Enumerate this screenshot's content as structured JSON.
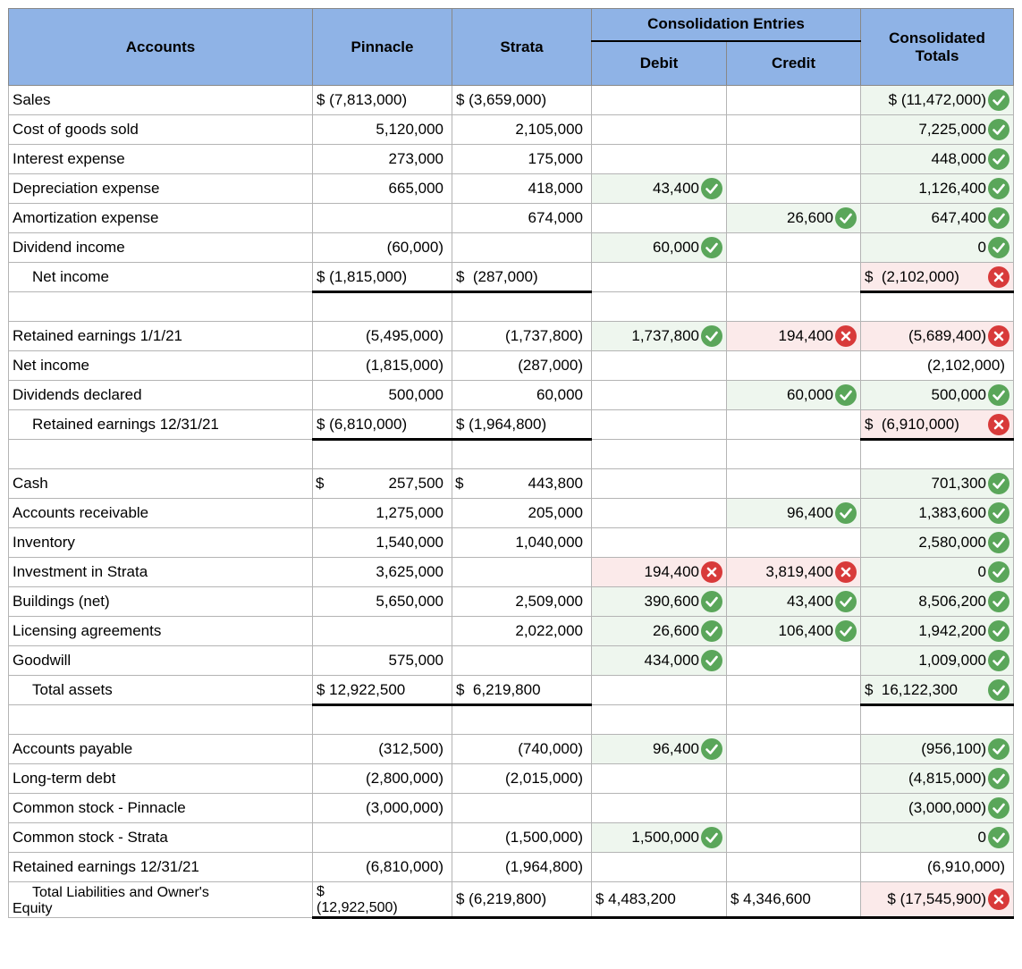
{
  "headers": {
    "accounts": "Accounts",
    "pinnacle": "Pinnacle",
    "strata": "Strata",
    "consolidation": "Consolidation Entries",
    "debit": "Debit",
    "credit": "Credit",
    "totals_line1": "Consolidated",
    "totals_line2": "Totals"
  },
  "status_colors": {
    "correct": "#5aa65a",
    "incorrect": "#d83a3a"
  },
  "rows": [
    {
      "type": "row",
      "name": "Sales",
      "p": "$ (7,813,000)",
      "s": "$ (3,659,000)",
      "d": "",
      "c": "",
      "t": "$ (11,472,000)",
      "ts": "correct"
    },
    {
      "type": "row",
      "name": "Cost of goods sold",
      "p": "5,120,000",
      "s": "2,105,000",
      "d": "",
      "c": "",
      "t": "7,225,000",
      "ts": "correct"
    },
    {
      "type": "row",
      "name": "Interest expense",
      "p": "273,000",
      "s": "175,000",
      "d": "",
      "c": "",
      "t": "448,000",
      "ts": "correct"
    },
    {
      "type": "row",
      "name": "Depreciation expense",
      "p": "665,000",
      "s": "418,000",
      "d": "43,400",
      "ds": "correct",
      "c": "",
      "t": "1,126,400",
      "ts": "correct"
    },
    {
      "type": "row",
      "name": "Amortization expense",
      "p": "",
      "s": "674,000",
      "d": "",
      "c": "26,600",
      "cs": "correct",
      "t": "647,400",
      "ts": "correct"
    },
    {
      "type": "row",
      "name": "Dividend income",
      "p": "(60,000)",
      "s": "",
      "d": "60,000",
      "ds": "correct",
      "c": "",
      "t": "0",
      "ts": "correct"
    },
    {
      "type": "total",
      "name": "Net income",
      "p": "$ (1,815,000)",
      "s": "$ (287,000)",
      "sgap": true,
      "d": "",
      "c": "",
      "t": "$ (2,102,000)",
      "tgap": true,
      "ts": "incorrect"
    },
    {
      "type": "spacer"
    },
    {
      "type": "row",
      "name": "Retained earnings 1/1/21",
      "p": "(5,495,000)",
      "s": "(1,737,800)",
      "d": "1,737,800",
      "ds": "correct",
      "c": "194,400",
      "cs": "incorrect",
      "t": "(5,689,400)",
      "ts": "incorrect"
    },
    {
      "type": "row",
      "name": "Net income",
      "p": "(1,815,000)",
      "s": "(287,000)",
      "d": "",
      "c": "",
      "t": "(2,102,000)",
      "tplain": true
    },
    {
      "type": "row",
      "name": "Dividends declared",
      "p": "500,000",
      "s": "60,000",
      "d": "",
      "c": "60,000",
      "cs": "correct",
      "t": "500,000",
      "ts": "correct"
    },
    {
      "type": "total",
      "name": "Retained earnings 12/31/21",
      "p": "$ (6,810,000)",
      "s": "$ (1,964,800)",
      "d": "",
      "c": "",
      "t": "$ (6,910,000)",
      "tgap": true,
      "ts": "incorrect"
    },
    {
      "type": "spacer"
    },
    {
      "type": "row",
      "name": "Cash",
      "p": "$ 257,500",
      "pgap": true,
      "s": "$ 443,800",
      "sgap": true,
      "d": "",
      "c": "",
      "t": "701,300",
      "ts": "correct"
    },
    {
      "type": "row",
      "name": "Accounts receivable",
      "p": "1,275,000",
      "s": "205,000",
      "d": "",
      "c": "96,400",
      "cs": "correct",
      "t": "1,383,600",
      "ts": "correct"
    },
    {
      "type": "row",
      "name": "Inventory",
      "p": "1,540,000",
      "s": "1,040,000",
      "d": "",
      "c": "",
      "t": "2,580,000",
      "ts": "correct"
    },
    {
      "type": "row",
      "name": "Investment in Strata",
      "p": "3,625,000",
      "s": "",
      "d": "194,400",
      "ds": "incorrect",
      "c": "3,819,400",
      "cs": "incorrect",
      "t": "0",
      "ts": "correct"
    },
    {
      "type": "row",
      "name": "Buildings (net)",
      "p": "5,650,000",
      "s": "2,509,000",
      "d": "390,600",
      "ds": "correct",
      "c": "43,400",
      "cs": "correct",
      "t": "8,506,200",
      "ts": "correct"
    },
    {
      "type": "row",
      "name": "Licensing agreements",
      "p": "",
      "s": "2,022,000",
      "d": "26,600",
      "ds": "correct",
      "c": "106,400",
      "cs": "correct",
      "t": "1,942,200",
      "ts": "correct"
    },
    {
      "type": "row",
      "name": "Goodwill",
      "p": "575,000",
      "s": "",
      "d": "434,000",
      "ds": "correct",
      "c": "",
      "t": "1,009,000",
      "ts": "correct"
    },
    {
      "type": "total",
      "name": "Total assets",
      "p": "$ 12,922,500",
      "s": "$ 6,219,800",
      "sgap": true,
      "d": "",
      "c": "",
      "t": "$ 16,122,300",
      "tgap": true,
      "ts": "correct"
    },
    {
      "type": "spacer"
    },
    {
      "type": "row",
      "name": "Accounts payable",
      "p": "(312,500)",
      "s": "(740,000)",
      "d": "96,400",
      "ds": "correct",
      "c": "",
      "t": "(956,100)",
      "ts": "correct"
    },
    {
      "type": "row",
      "name": "Long-term debt",
      "p": "(2,800,000)",
      "s": "(2,015,000)",
      "d": "",
      "c": "",
      "t": "(4,815,000)",
      "ts": "correct"
    },
    {
      "type": "row",
      "name": "Common stock - Pinnacle",
      "p": "(3,000,000)",
      "s": "",
      "d": "",
      "c": "",
      "t": "(3,000,000)",
      "ts": "correct"
    },
    {
      "type": "row",
      "name": "Common stock - Strata",
      "p": "",
      "s": "(1,500,000)",
      "d": "1,500,000",
      "ds": "correct",
      "c": "",
      "t": "0",
      "ts": "correct"
    },
    {
      "type": "row",
      "name": "Retained earnings 12/31/21",
      "p": "(6,810,000)",
      "s": "(1,964,800)",
      "d": "",
      "c": "",
      "t": "(6,910,000)",
      "tplain": true
    },
    {
      "type": "last",
      "name_line1": "Total Liabilities and Owner's",
      "name_line2": "Equity",
      "p_line1": "$",
      "p_line2": "(12,922,500)",
      "s": "$ (6,219,800)",
      "d": "$ 4,483,200",
      "c": "$ 4,346,600",
      "t": "$ (17,545,900)",
      "ts": "incorrect"
    }
  ]
}
